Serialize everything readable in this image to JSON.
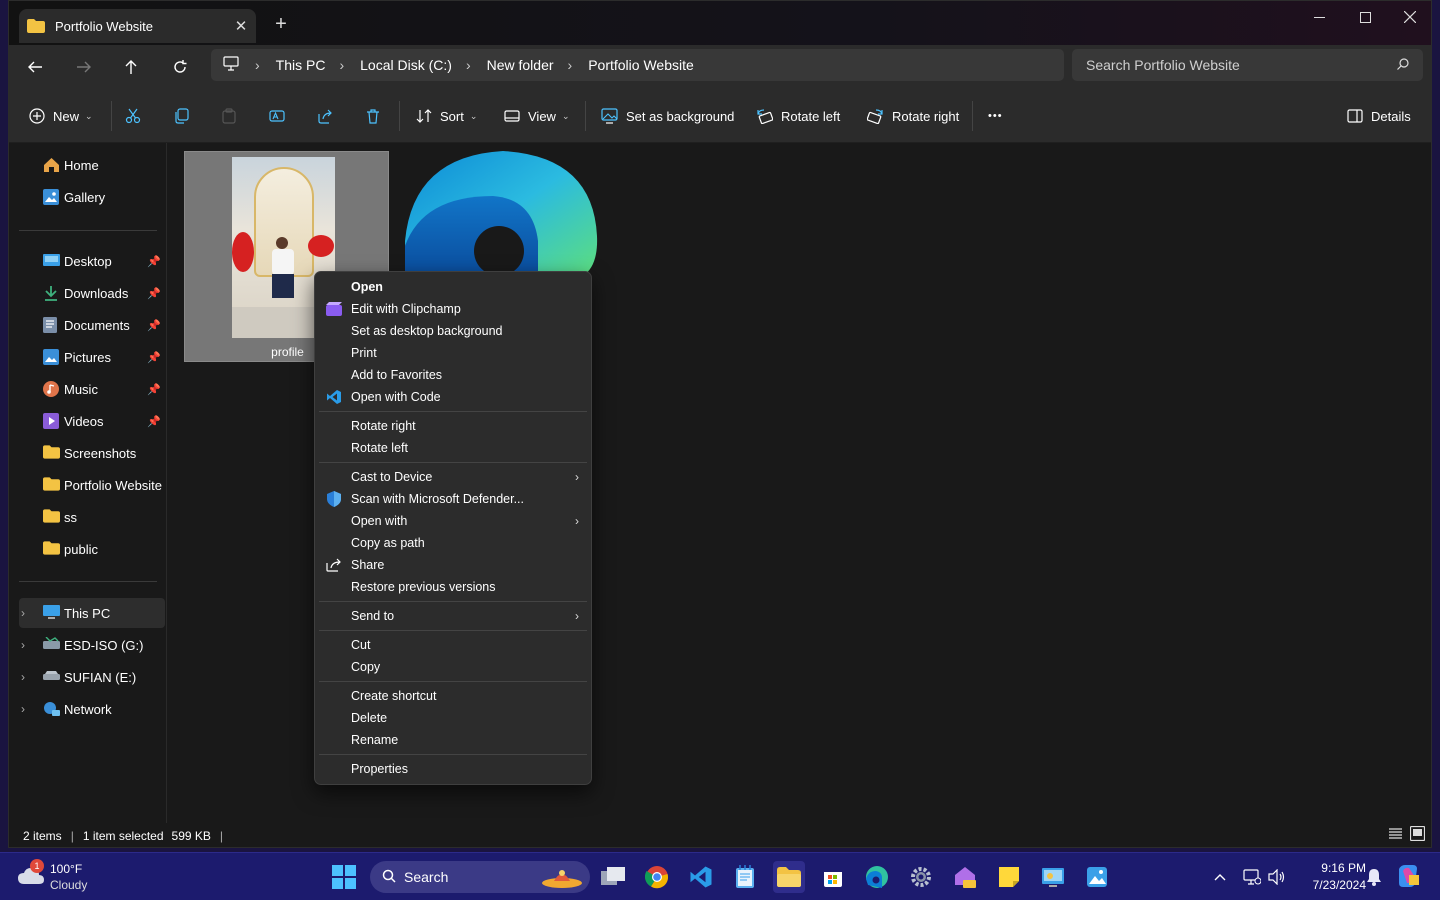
{
  "window": {
    "tab_title": "Portfolio Website",
    "new_tab_label": "+",
    "close_tab_label": "✕"
  },
  "nav": {
    "breadcrumbs": [
      "This PC",
      "Local Disk (C:)",
      "New folder",
      "Portfolio Website"
    ],
    "search_placeholder": "Search Portfolio Website"
  },
  "toolbar": {
    "new_label": "New",
    "sort_label": "Sort",
    "view_label": "View",
    "set_bg_label": "Set as background",
    "rotate_left_label": "Rotate left",
    "rotate_right_label": "Rotate right",
    "more_label": "•••",
    "details_label": "Details"
  },
  "sidebar": {
    "home": "Home",
    "gallery": "Gallery",
    "pinned": [
      {
        "label": "Desktop",
        "icon": "desktop-icon",
        "color": "#3aa0e8"
      },
      {
        "label": "Downloads",
        "icon": "download-icon",
        "color": "#3fb27f"
      },
      {
        "label": "Documents",
        "icon": "documents-icon",
        "color": "#7a8ea8"
      },
      {
        "label": "Pictures",
        "icon": "pictures-icon",
        "color": "#3a8fd8"
      },
      {
        "label": "Music",
        "icon": "music-icon",
        "color": "#e0744a"
      },
      {
        "label": "Videos",
        "icon": "videos-icon",
        "color": "#8a5cd8"
      }
    ],
    "folders": [
      "Screenshots",
      "Portfolio Website",
      "ss",
      "public"
    ],
    "drives": [
      {
        "label": "This PC",
        "icon": "this-pc-icon"
      },
      {
        "label": "ESD-ISO (G:)",
        "icon": "drive-icon"
      },
      {
        "label": "SUFIAN (E:)",
        "icon": "drive-icon"
      },
      {
        "label": "Network",
        "icon": "network-icon"
      }
    ]
  },
  "files": {
    "selected_name": "profile"
  },
  "context_menu": {
    "group1": [
      {
        "label": "Open",
        "bold": true,
        "icon": ""
      },
      {
        "label": "Edit with Clipchamp",
        "icon": "clipchamp-icon"
      },
      {
        "label": "Set as desktop background",
        "icon": ""
      },
      {
        "label": "Print",
        "icon": ""
      },
      {
        "label": "Add to Favorites",
        "icon": ""
      },
      {
        "label": "Open with Code",
        "icon": "vscode-icon"
      }
    ],
    "group2": [
      {
        "label": "Rotate right"
      },
      {
        "label": "Rotate left"
      }
    ],
    "group3": [
      {
        "label": "Cast to Device",
        "submenu": true
      },
      {
        "label": "Scan with Microsoft Defender...",
        "icon": "defender-icon"
      },
      {
        "label": "Open with",
        "submenu": true
      },
      {
        "label": "Copy as path"
      },
      {
        "label": "Share",
        "icon": "share-icon"
      },
      {
        "label": "Restore previous versions"
      }
    ],
    "group4": [
      {
        "label": "Send to",
        "submenu": true
      }
    ],
    "group5": [
      {
        "label": "Cut"
      },
      {
        "label": "Copy"
      }
    ],
    "group6": [
      {
        "label": "Create shortcut"
      },
      {
        "label": "Delete"
      },
      {
        "label": "Rename"
      }
    ],
    "group7": [
      {
        "label": "Properties"
      }
    ]
  },
  "status": {
    "items": "2 items",
    "selected": "1 item selected",
    "size": "599 KB"
  },
  "taskbar": {
    "weather_temp": "100°F",
    "weather_desc": "Cloudy",
    "weather_badge": "1",
    "search_label": "Search",
    "time": "9:16 PM",
    "date": "7/23/2024"
  },
  "colors": {
    "accent": "#4cc2ff",
    "folder": "#f3c343",
    "taskbar": "#1c1b6e"
  }
}
